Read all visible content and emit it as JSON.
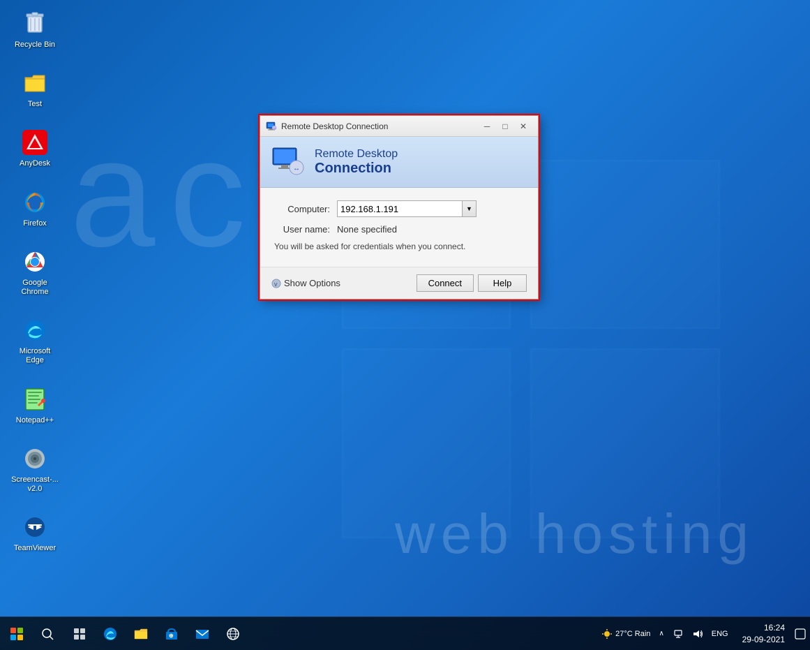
{
  "desktop": {
    "icons": [
      {
        "id": "recycle-bin",
        "label": "Recycle Bin",
        "icon": "recycle"
      },
      {
        "id": "test",
        "label": "Test",
        "icon": "folder-test"
      },
      {
        "id": "anydesk",
        "label": "AnyDesk",
        "icon": "anydesk"
      },
      {
        "id": "firefox",
        "label": "Firefox",
        "icon": "firefox"
      },
      {
        "id": "google-chrome",
        "label": "Google Chrome",
        "icon": "chrome"
      },
      {
        "id": "microsoft-edge",
        "label": "Microsoft Edge",
        "icon": "edge"
      },
      {
        "id": "notepadpp",
        "label": "Notepad++",
        "icon": "notepadpp"
      },
      {
        "id": "screencast",
        "label": "Screencast-... v2.0",
        "icon": "screencast"
      },
      {
        "id": "teamviewer",
        "label": "TeamViewer",
        "icon": "teamviewer"
      }
    ],
    "watermark_text": "acct",
    "watermark_sub": "web hosting"
  },
  "rdp_dialog": {
    "title": "Remote Desktop Connection",
    "header_line1": "Remote Desktop",
    "header_line2": "Connection",
    "computer_label": "Computer:",
    "computer_value": "192.168.1.191",
    "username_label": "User name:",
    "username_value": "None specified",
    "info_text": "You will be asked for credentials when you connect.",
    "show_options_label": "Show Options",
    "connect_button": "Connect",
    "help_button": "Help",
    "window_buttons": {
      "minimize": "─",
      "maximize": "□",
      "close": "✕"
    }
  },
  "taskbar": {
    "search_circle_label": "Search",
    "weather": "27°C Rain",
    "language": "ENG",
    "time": "16:24",
    "date": "29-09-2021",
    "notification_icon": "🔔"
  }
}
